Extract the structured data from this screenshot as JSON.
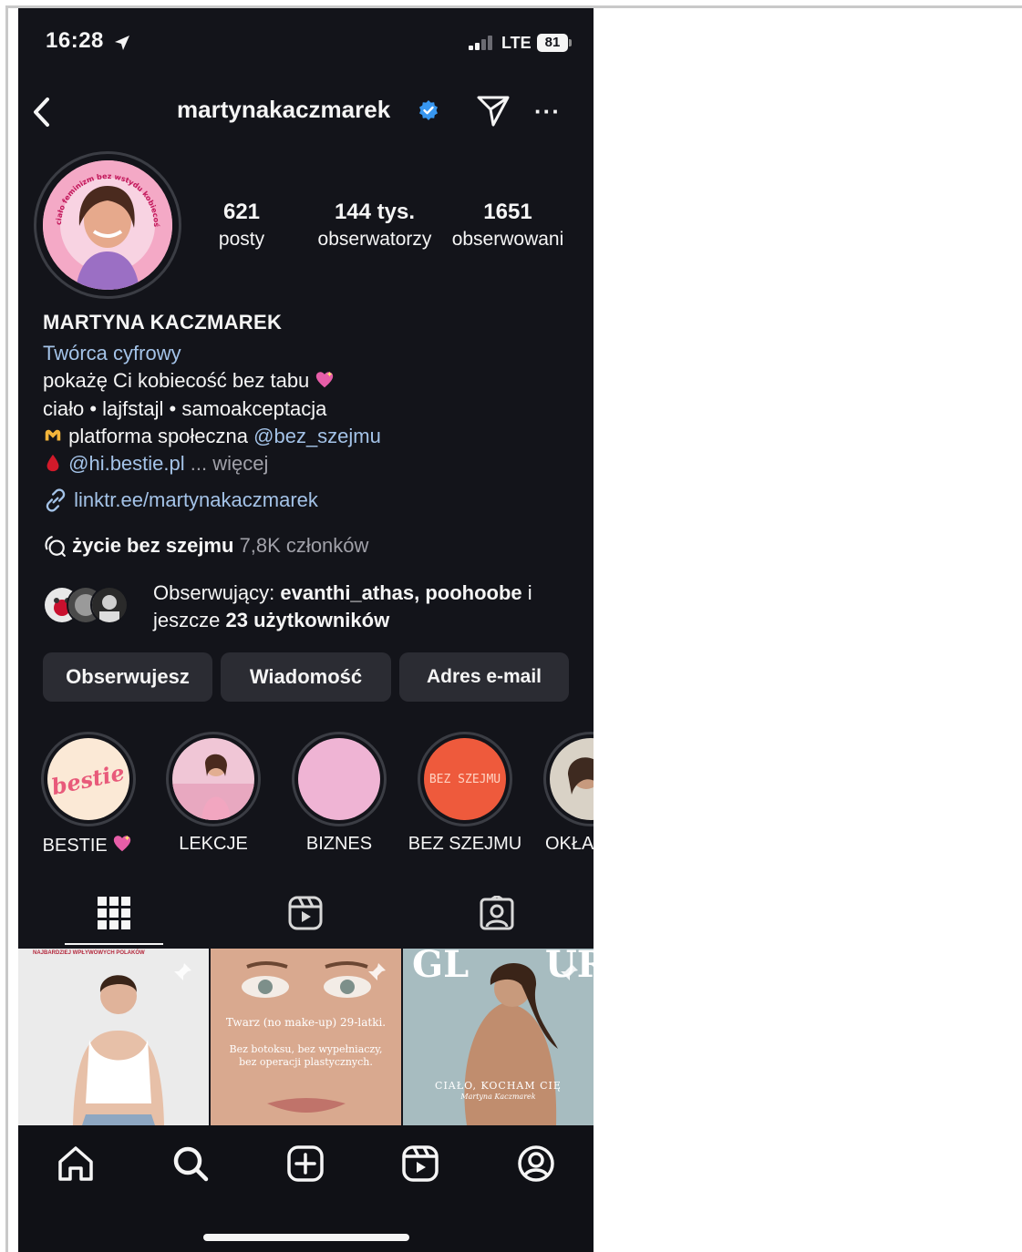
{
  "status_bar": {
    "time": "16:28",
    "network": "LTE",
    "battery": "81"
  },
  "header": {
    "username": "martynakaczmarek"
  },
  "stats": {
    "posts": {
      "value": "621",
      "label": "posty"
    },
    "followers": {
      "value": "144 tys.",
      "label": "obserwatorzy"
    },
    "following": {
      "value": "1651",
      "label": "obserwowani"
    }
  },
  "bio": {
    "name": "MARTYNA KACZMAREK",
    "category": "Twórca cyfrowy",
    "line1": "pokażę Ci kobiecość bez tabu",
    "line2": "ciało • lajfstajl • samoakceptacja",
    "line3_text": "platforma społeczna",
    "line3_handle": "@bez_szejmu",
    "line4_handle": "@hi.bestie.pl",
    "line4_more": "... więcej",
    "link": "linktr.ee/martynakaczmarek",
    "channel_name": "życie bez szejmu",
    "channel_members": "7,8K członków",
    "avatar_ring_text": "ciało feminizm bez wstydu kobiecość"
  },
  "followed_by": {
    "prefix": "Obserwujący:",
    "names": "evanthi_athas, poohoobe",
    "conj": "i",
    "suffix_prefix": "jeszcze",
    "count_text": "23 użytkowników"
  },
  "buttons": {
    "follow": "Obserwujesz",
    "message": "Wiadomość",
    "email": "Adres e-mail"
  },
  "highlights": [
    {
      "label": "BESTIE",
      "cover_text": "bestie"
    },
    {
      "label": "LEKCJE"
    },
    {
      "label": "BIZNES"
    },
    {
      "label": "BEZ SZEJMU",
      "cover_text": "BEZ SZEJMU"
    },
    {
      "label": "OKŁA"
    }
  ],
  "posts": [
    {
      "caption": "NAJBARDZIEJ WPŁYWOWYCH POLAKÓW"
    },
    {
      "caption_1": "Twarz (no make-up) 29-latki.",
      "caption_2": "Bez botoksu, bez wypełniaczy, bez operacji plastycznych."
    },
    {
      "title": "GL      UR",
      "caption_1": "CIAŁO, KOCHAM CIĘ",
      "caption_2": "Martyna Kaczmarek"
    }
  ],
  "colors": {
    "background": "#13141a",
    "link": "#a4c3e8",
    "button": "#2b2c33",
    "verified": "#3897f0"
  }
}
